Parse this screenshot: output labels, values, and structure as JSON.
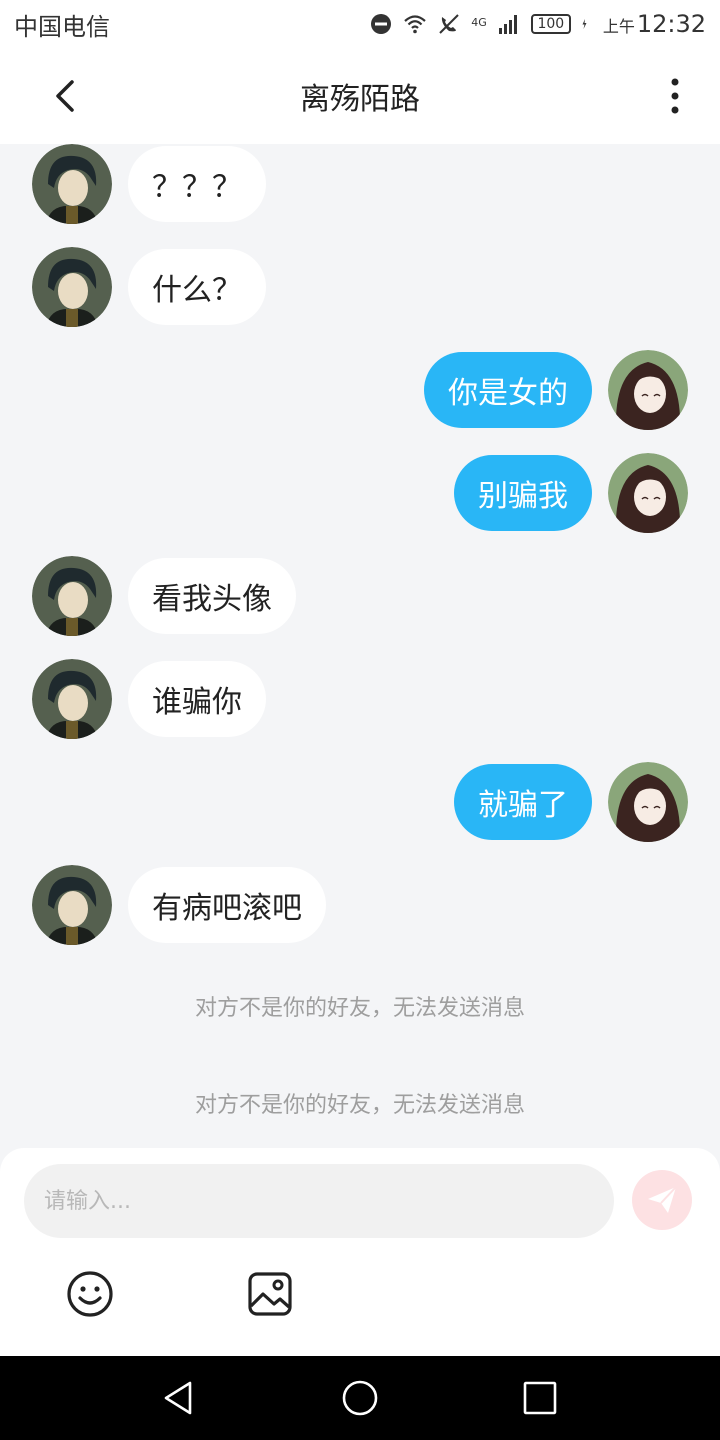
{
  "status_bar": {
    "carrier": "中国电信",
    "network": "4G",
    "battery": "100",
    "time_prefix": "上午",
    "time": "12:32"
  },
  "header": {
    "title": "离殇陌路"
  },
  "messages": [
    {
      "side": "left",
      "text": "？？？"
    },
    {
      "side": "left",
      "text": "什么？"
    },
    {
      "side": "right",
      "text": "你是女的"
    },
    {
      "side": "right",
      "text": "别骗我"
    },
    {
      "side": "left",
      "text": "看我头像"
    },
    {
      "side": "left",
      "text": "谁骗你"
    },
    {
      "side": "right",
      "text": "就骗了"
    },
    {
      "side": "left",
      "text": "有病吧滚吧"
    }
  ],
  "notices": [
    "对方不是你的好友，无法发送消息",
    "对方不是你的好友，无法发送消息"
  ],
  "input": {
    "placeholder": "请输入...",
    "value": ""
  },
  "colors": {
    "accent_blue": "#29b6f6",
    "send_button": "#fde1e3",
    "background": "#f4f5f7"
  },
  "icons": {
    "back": "chevron-left-icon",
    "more": "more-vertical-icon",
    "send": "send-icon",
    "emoji": "emoji-icon",
    "image": "image-icon"
  }
}
